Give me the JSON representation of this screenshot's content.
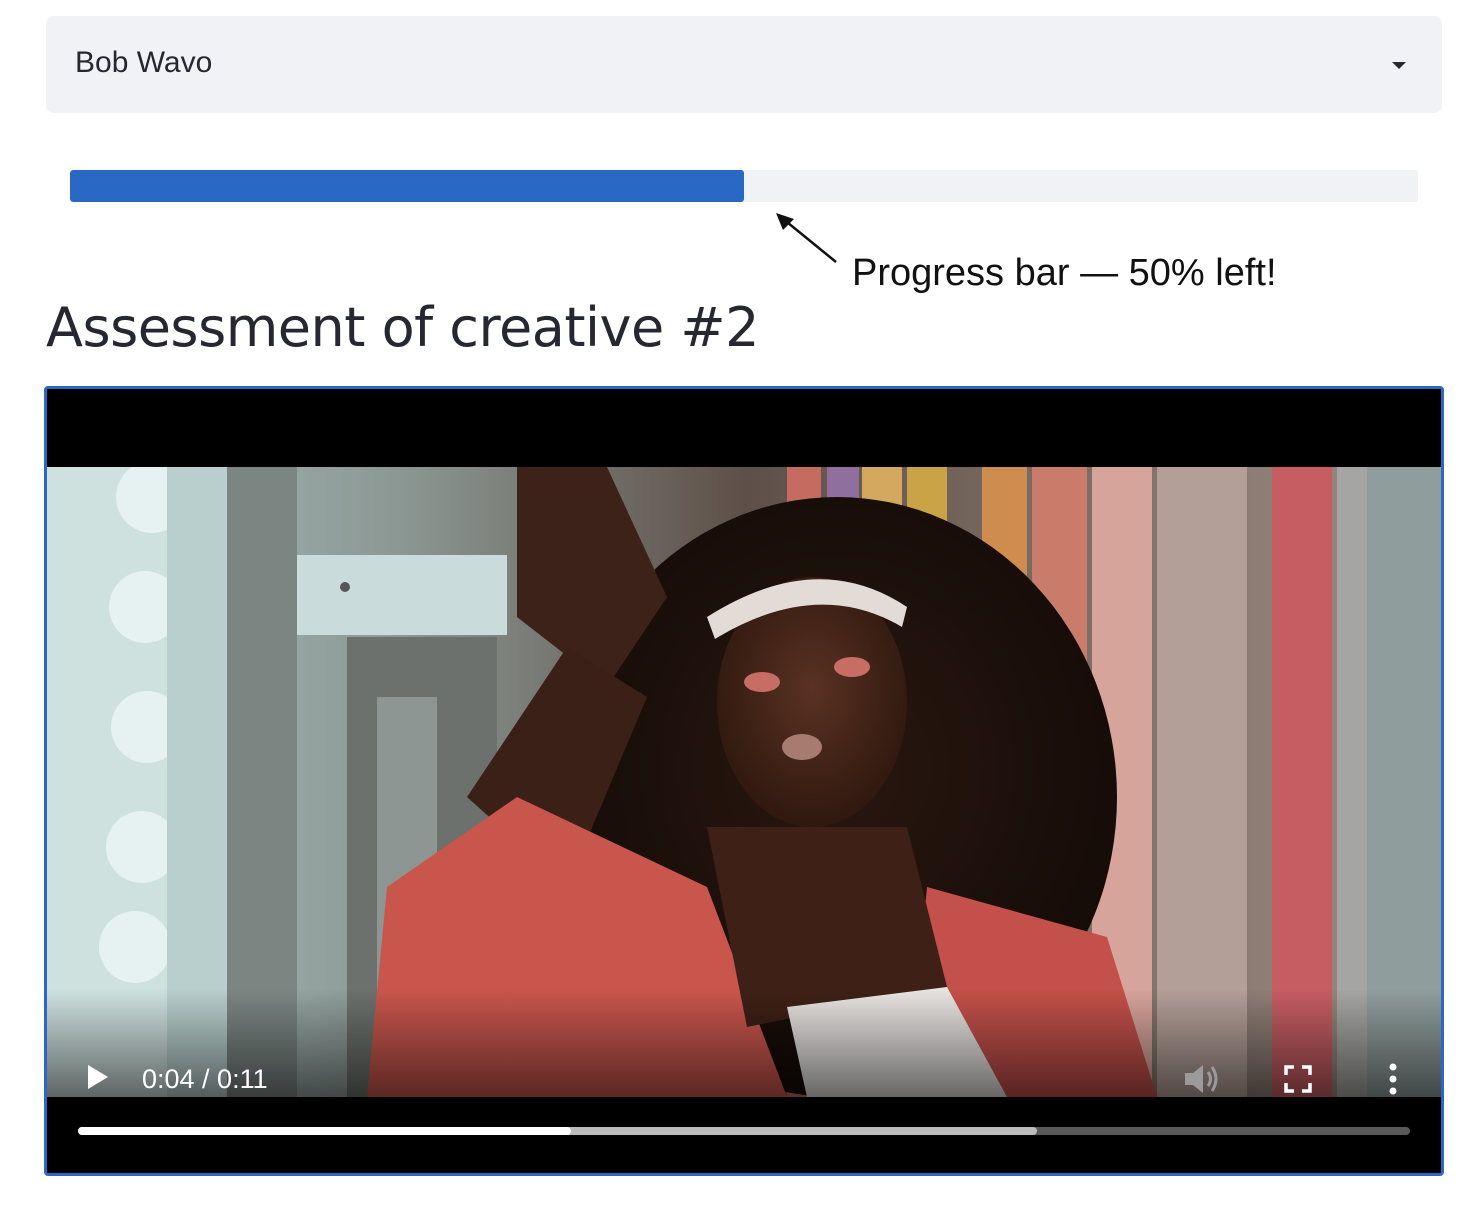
{
  "selectbox": {
    "selected": "Bob Wavo"
  },
  "progress": {
    "fraction": 0.5
  },
  "annotation": {
    "text": "Progress bar — 50% left!"
  },
  "heading": {
    "title": "Assessment of creative #2"
  },
  "video": {
    "time_label": "0:04 / 0:11",
    "played_fraction": 0.37,
    "buffered_fraction": 0.72
  },
  "colors": {
    "accent": "#2a68c6",
    "select_bg": "#f0f2f6",
    "text": "#262730"
  },
  "icons": {
    "play": "play-icon",
    "volume": "volume-icon",
    "fullscreen": "fullscreen-icon",
    "more": "more-vertical-icon",
    "caret": "chevron-down-icon"
  }
}
